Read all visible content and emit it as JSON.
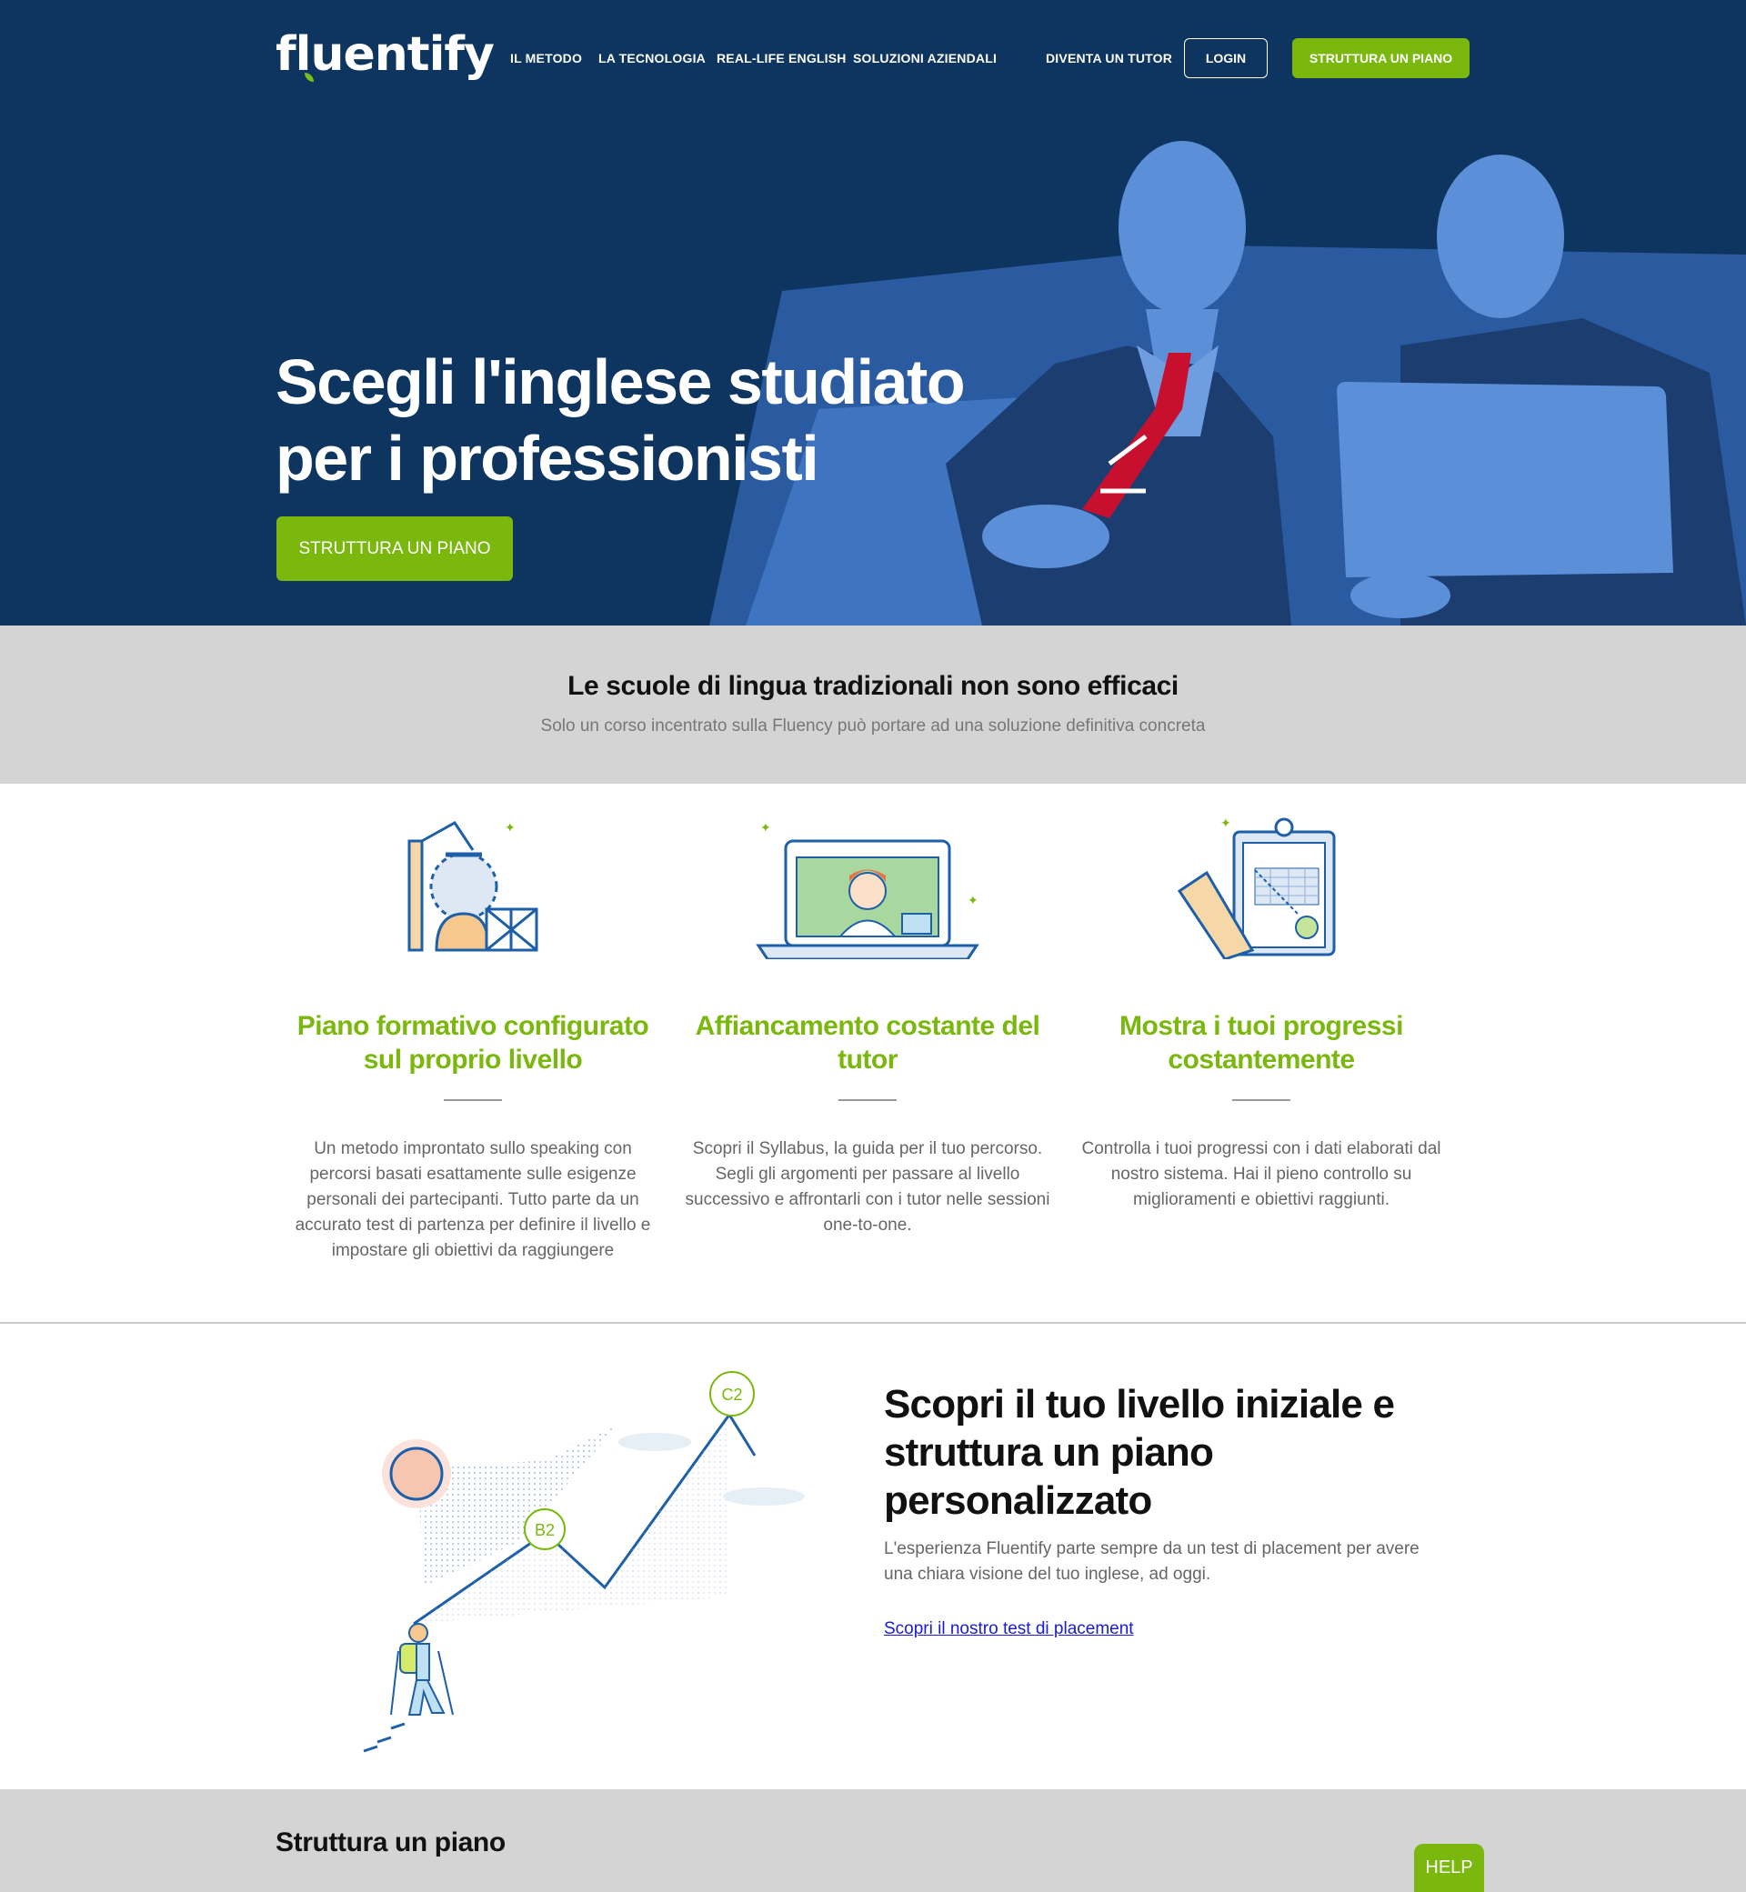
{
  "brand": {
    "name": "fluentify"
  },
  "nav": {
    "links": [
      "IL METODO",
      "LA TECNOLOGIA",
      "REAL-LIFE ENGLISH",
      "SOLUZIONI AZIENDALI"
    ],
    "tutor": "DIVENTA UN TUTOR",
    "login": "LOGIN",
    "cta": "STRUTTURA UN PIANO"
  },
  "hero": {
    "title_line1": "Scegli l'inglese studiato",
    "title_line2": "per i professionisti",
    "cta": "STRUTTURA UN PIANO"
  },
  "band": {
    "title": "Le scuole di lingua tradizionali non sono efficaci",
    "subtitle": "Solo un corso incentrato sulla Fluency può portare ad una soluzione definitiva concreta"
  },
  "features": [
    {
      "title_line1": "Piano formativo configurato",
      "title_line2": "sul proprio livello",
      "text": "Un metodo improntato sullo speaking con percorsi basati esattamente sulle esigenze personali dei partecipanti. Tutto parte da un accurato test di partenza per definire il livello e impostare gli obiettivi da raggiungere",
      "icon": "building-icon"
    },
    {
      "title_line1": "Affiancamento costante del",
      "title_line2": "tutor",
      "text": "Scopri il Syllabus, la guida per il tuo percorso. Segli gli argomenti per passare al livello successivo e affrontarli con i tutor nelle sessioni one-to-one.",
      "icon": "laptop-video-call-icon"
    },
    {
      "title_line1": "Mostra i tuoi progressi",
      "title_line2": "costantemente",
      "text": "Controlla i tuoi progressi con i dati elaborati dal nostro sistema. Hai il pieno controllo su miglioramenti e obiettivi raggiunti.",
      "icon": "clipboard-chart-icon"
    }
  ],
  "placement": {
    "title": "Scopri il tuo livello iniziale e struttura un piano personalizzato",
    "text": "L'esperienza Fluentify parte sempre da un test di placement per avere una chiara visione del tuo inglese, ad oggi.",
    "link": "Scopri il nostro test di placement",
    "badge_low": "B2",
    "badge_high": "C2"
  },
  "bottom": {
    "title": "Struttura un piano"
  },
  "help": "HELP",
  "colors": {
    "navy": "#0d3560",
    "green": "#7ab80e",
    "gray": "#d4d4d4"
  }
}
